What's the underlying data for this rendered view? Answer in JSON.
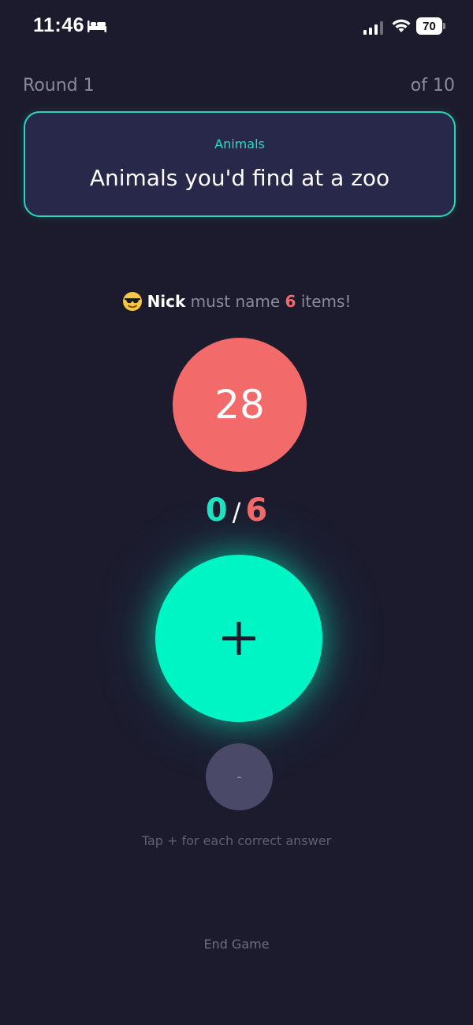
{
  "status_bar": {
    "time": "11:46",
    "battery": "70"
  },
  "round": {
    "label": "Round 1",
    "total": "of 10"
  },
  "category": {
    "name": "Animals",
    "prompt": "Animals you'd find at a zoo"
  },
  "player": {
    "emoji": "smiling-face-with-sunglasses-icon",
    "name": "Nick",
    "text_before": "must name",
    "count": "6",
    "text_after": "items!"
  },
  "timer": {
    "seconds": "28"
  },
  "score": {
    "current": "0",
    "separator": "/",
    "target": "6"
  },
  "controls": {
    "minus_label": "-",
    "hint": "Tap + for each correct answer",
    "end_game": "End Game"
  },
  "colors": {
    "background": "#1c1b2e",
    "accent_teal": "#00f5c4",
    "accent_red": "#f26a6a",
    "card_border": "#24d8b8"
  }
}
